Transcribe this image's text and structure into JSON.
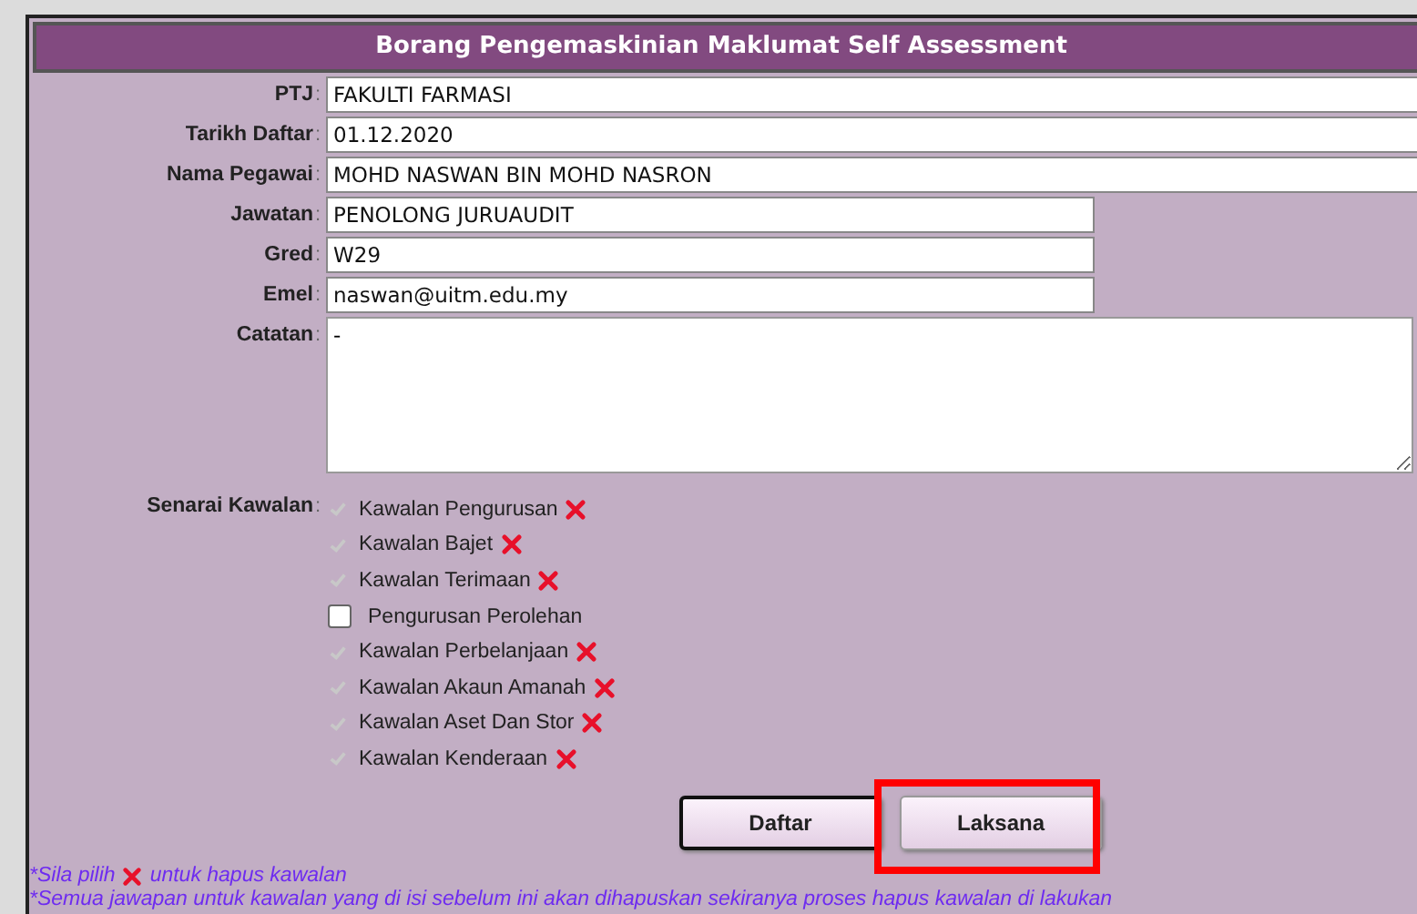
{
  "form": {
    "title": "Borang Pengemaskinian Maklumat Self Assessment"
  },
  "fields": [
    {
      "label": "PTJ",
      "separator": ":",
      "value": "FAKULTI FARMASI",
      "kind": "wide"
    },
    {
      "label": "Tarikh Daftar",
      "separator": ":",
      "value": "01.12.2020",
      "kind": "wide"
    },
    {
      "label": "Nama Pegawai",
      "separator": ":",
      "value": "MOHD NASWAN BIN MOHD NASRON",
      "kind": "wide"
    },
    {
      "label": "Jawatan",
      "separator": ":",
      "value": "PENOLONG JURUAUDIT",
      "kind": "short"
    },
    {
      "label": "Gred",
      "separator": ":",
      "value": "W29",
      "kind": "short"
    },
    {
      "label": "Emel",
      "separator": ":",
      "value": "naswan@uitm.edu.my",
      "kind": "short"
    },
    {
      "label": "Catatan",
      "separator": ":",
      "value": "-",
      "kind": "textarea"
    }
  ],
  "controls": {
    "label": "Senarai Kawalan",
    "separator": ":",
    "items": [
      {
        "label": "Kawalan Pengurusan",
        "checked": true,
        "disabled": true,
        "removable": true
      },
      {
        "label": "Kawalan Bajet",
        "checked": true,
        "disabled": true,
        "removable": true
      },
      {
        "label": "Kawalan Terimaan",
        "checked": true,
        "disabled": true,
        "removable": true
      },
      {
        "label": "Pengurusan Perolehan",
        "checked": false,
        "disabled": false,
        "removable": false
      },
      {
        "label": "Kawalan Perbelanjaan",
        "checked": true,
        "disabled": true,
        "removable": true
      },
      {
        "label": "Kawalan Akaun Amanah",
        "checked": true,
        "disabled": true,
        "removable": true
      },
      {
        "label": "Kawalan Aset Dan Stor",
        "checked": true,
        "disabled": true,
        "removable": true
      },
      {
        "label": "Kawalan Kenderaan",
        "checked": true,
        "disabled": true,
        "removable": true
      }
    ]
  },
  "buttons": [
    {
      "label": "Daftar",
      "focused": true,
      "highlighted": false
    },
    {
      "label": "Laksana",
      "focused": false,
      "highlighted": true
    }
  ],
  "notes": [
    {
      "kind": "icon",
      "text": "*Sila pilih",
      "text_after": "untuk hapus kawalan"
    },
    {
      "kind": "plain",
      "text": "*Semua jawapan untuk kawalan yang di isi sebelum ini akan dihapuskan sekiranya proses hapus kawalan di lakukan"
    }
  ]
}
